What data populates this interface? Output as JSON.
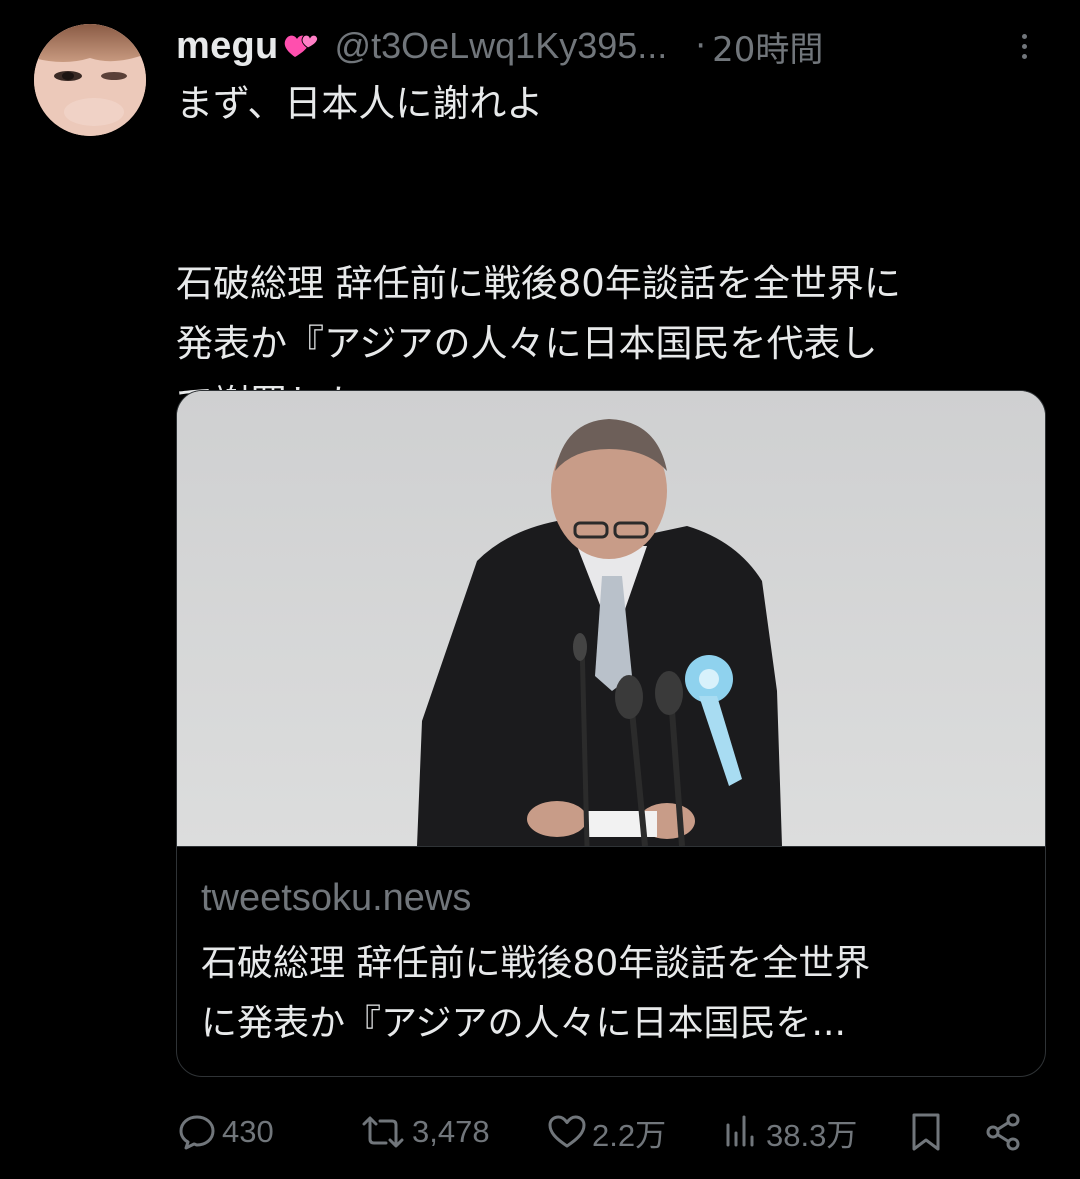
{
  "user": {
    "display_name": "megu",
    "emoji_icon": "two-hearts-icon",
    "handle": "@t3OeLwq1Ky395...",
    "separator": "·",
    "time": "20時間"
  },
  "tweet": {
    "lines": [
      "まず、日本人に謝れよ",
      "石破総理 辞任前に戦後80年談話を全世界に",
      "発表か『アジアの人々に日本国民を代表し",
      "て謝罪したい』"
    ]
  },
  "card": {
    "domain": "tweetsoku.news",
    "title_lines": [
      "石破総理 辞任前に戦後80年談話を全世界",
      "に発表か『アジアの人々に日本国民を..."
    ]
  },
  "actions": {
    "replies": "430",
    "reposts": "3,478",
    "likes": "2.2万",
    "views": "38.3万"
  },
  "colors": {
    "background": "#000000",
    "text": "#e7e9ea",
    "muted": "#71767b",
    "border": "#2f3336",
    "emoji_pink": "#ff4fae"
  }
}
